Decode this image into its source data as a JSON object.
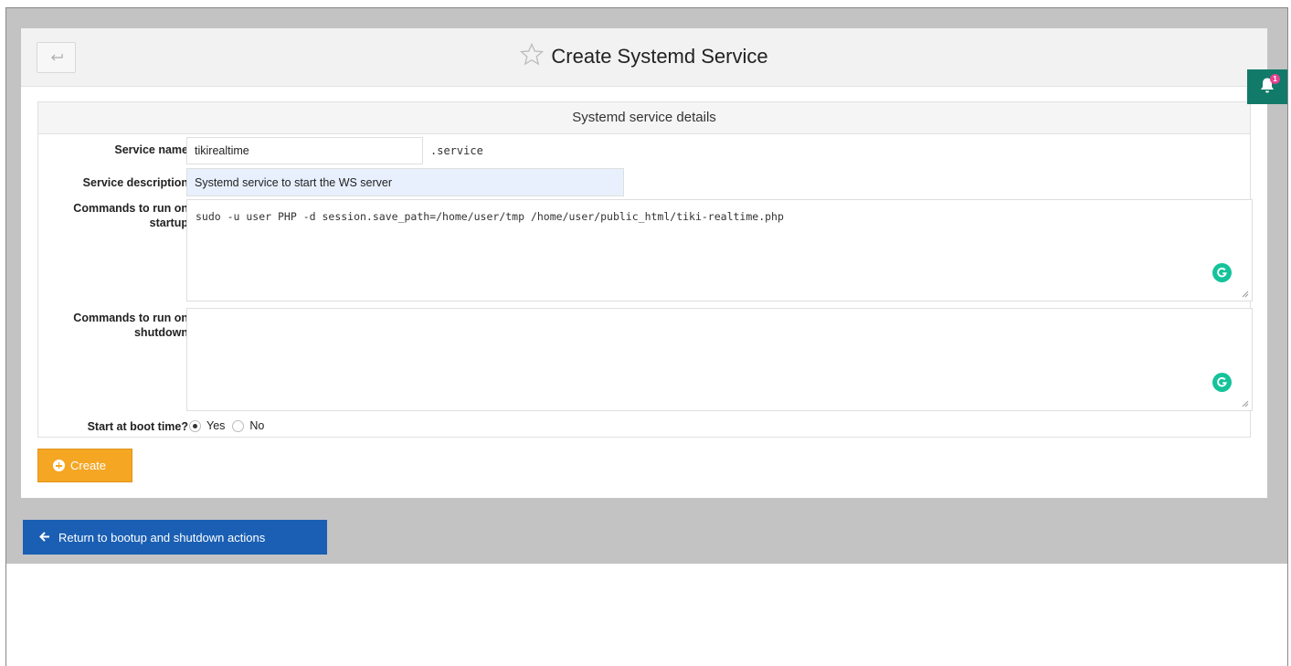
{
  "header": {
    "back_icon": "return-arrow-icon",
    "star_icon": "star-outline-icon",
    "title": "Create Systemd Service"
  },
  "notifications": {
    "icon": "bell-icon",
    "count": "1"
  },
  "details": {
    "heading": "Systemd service details",
    "service_name_label": "Service name",
    "service_name_value": "tikirealtime",
    "service_suffix": ".service",
    "description_label": "Service description",
    "description_value": "Systemd service to start the WS server",
    "startup_label_line1": "Commands to run on",
    "startup_label_line2": "startup",
    "startup_value": "sudo -u user PHP -d session.save_path=/home/user/tmp /home/user/public_html/tiki-realtime.php",
    "shutdown_label_line1": "Commands to run on",
    "shutdown_label_line2": "shutdown",
    "shutdown_value": "",
    "boot_label": "Start at boot time?",
    "boot_options": [
      {
        "label": "Yes",
        "checked": true
      },
      {
        "label": "No",
        "checked": false
      }
    ],
    "grammarly_icon": "grammarly-g-icon"
  },
  "actions": {
    "create_label": "Create",
    "create_icon": "plus-circle-icon",
    "return_label": "Return to bootup and shutdown actions",
    "return_icon": "arrow-left-icon"
  },
  "colors": {
    "create_button": "#f5a623",
    "return_button": "#1a5fb4",
    "notification_bg": "#127a68",
    "grammarly": "#15c39a"
  }
}
